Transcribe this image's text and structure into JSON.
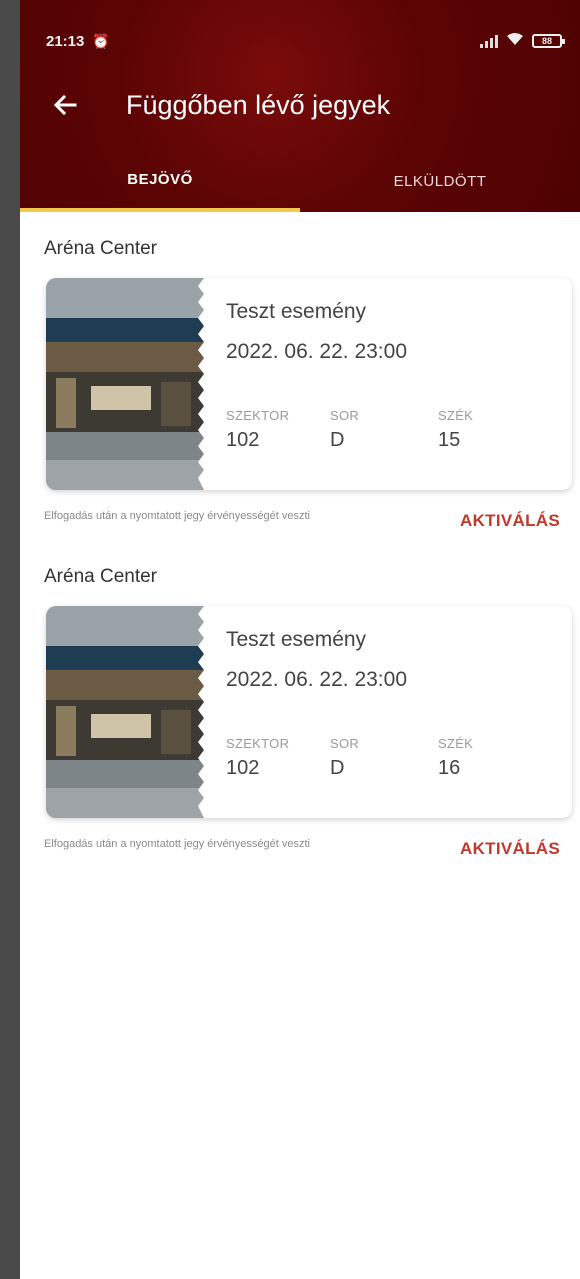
{
  "status_bar": {
    "time": "21:13",
    "notification_icon": "alarm-icon",
    "signal_icon": "signal-icon",
    "wifi_icon": "wifi-icon",
    "battery_label": "88"
  },
  "header": {
    "title": "Függőben lévő jegyek",
    "back_icon": "arrow-left-icon"
  },
  "tabs": [
    {
      "label": "BEJÖVŐ",
      "active": true
    },
    {
      "label": "ELKÜLDÖTT",
      "active": false
    }
  ],
  "colors": {
    "header_bg": "#5c0404",
    "tab_indicator": "#f2c94c",
    "action_red": "#c0392b"
  },
  "tickets": [
    {
      "venue": "Aréna Center",
      "event": "Teszt esemény",
      "date": "2022. 06. 22. 23:00",
      "sector_label": "SZEKTOR",
      "sector": "102",
      "row_label": "SOR",
      "row": "D",
      "seat_label": "SZÉK",
      "seat": "15",
      "note": "Elfogadás után a nyomtatott jegy érvényességét veszti",
      "action": "AKTIVÁLÁS"
    },
    {
      "venue": "Aréna Center",
      "event": "Teszt esemény",
      "date": "2022. 06. 22. 23:00",
      "sector_label": "SZEKTOR",
      "sector": "102",
      "row_label": "SOR",
      "row": "D",
      "seat_label": "SZÉK",
      "seat": "16",
      "note": "Elfogadás után a nyomtatott jegy érvényességét veszti",
      "action": "AKTIVÁLÁS"
    }
  ]
}
